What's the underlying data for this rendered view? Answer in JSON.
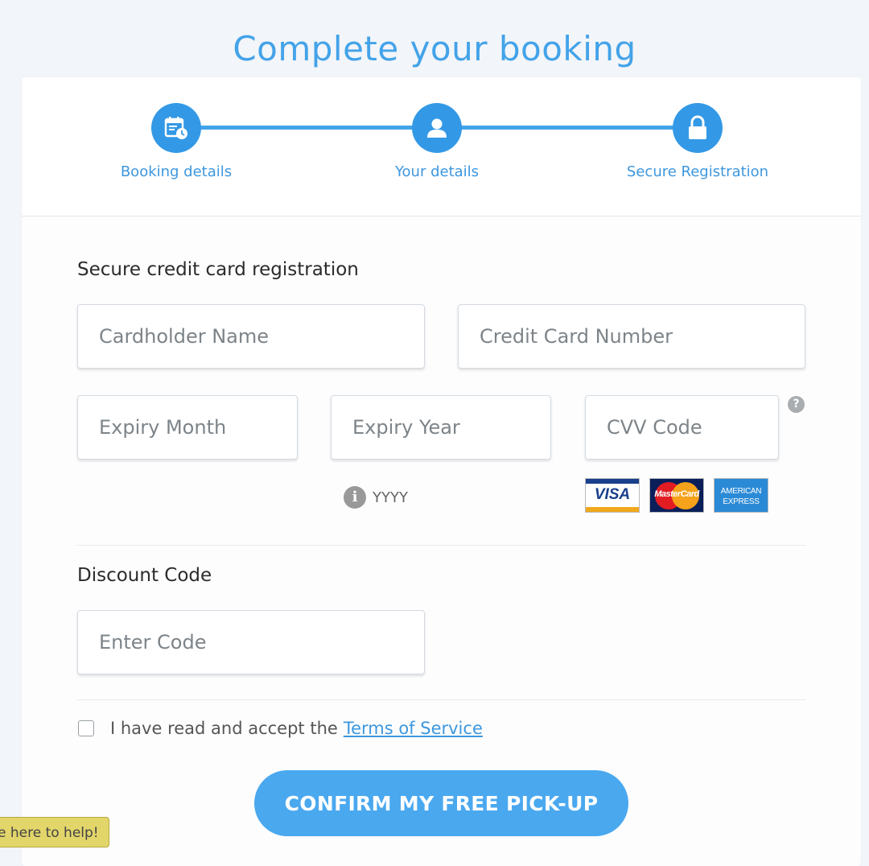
{
  "page": {
    "title": "Complete your booking"
  },
  "steps": [
    {
      "label": "Booking details",
      "icon": "calendar-clock-icon"
    },
    {
      "label": "Your details",
      "icon": "user-icon"
    },
    {
      "label": "Secure Registration",
      "icon": "lock-icon"
    }
  ],
  "credit_card": {
    "title": "Secure credit card registration",
    "cardholder_placeholder": "Cardholder Name",
    "number_placeholder": "Credit Card Number",
    "expiry_month_placeholder": "Expiry Month",
    "expiry_year_placeholder": "Expiry Year",
    "cvv_placeholder": "CVV Code",
    "help_icon_glyph": "?",
    "year_hint": "YYYY",
    "info_glyph": "i",
    "card_logos": [
      "VISA",
      "MasterCard",
      "AMERICAN",
      "EXPRESS"
    ]
  },
  "discount": {
    "title": "Discount Code",
    "placeholder": "Enter Code"
  },
  "terms": {
    "text": "I have read and accept the",
    "link": "Terms of Service"
  },
  "confirm_button": "CONFIRM MY FREE PICK-UP",
  "help_tab": "e here to help!",
  "colors": {
    "accent": "#43a3e9",
    "step_circle": "#3399e6",
    "button": "#4aa8ef",
    "help_tab": "#e2d56a"
  }
}
